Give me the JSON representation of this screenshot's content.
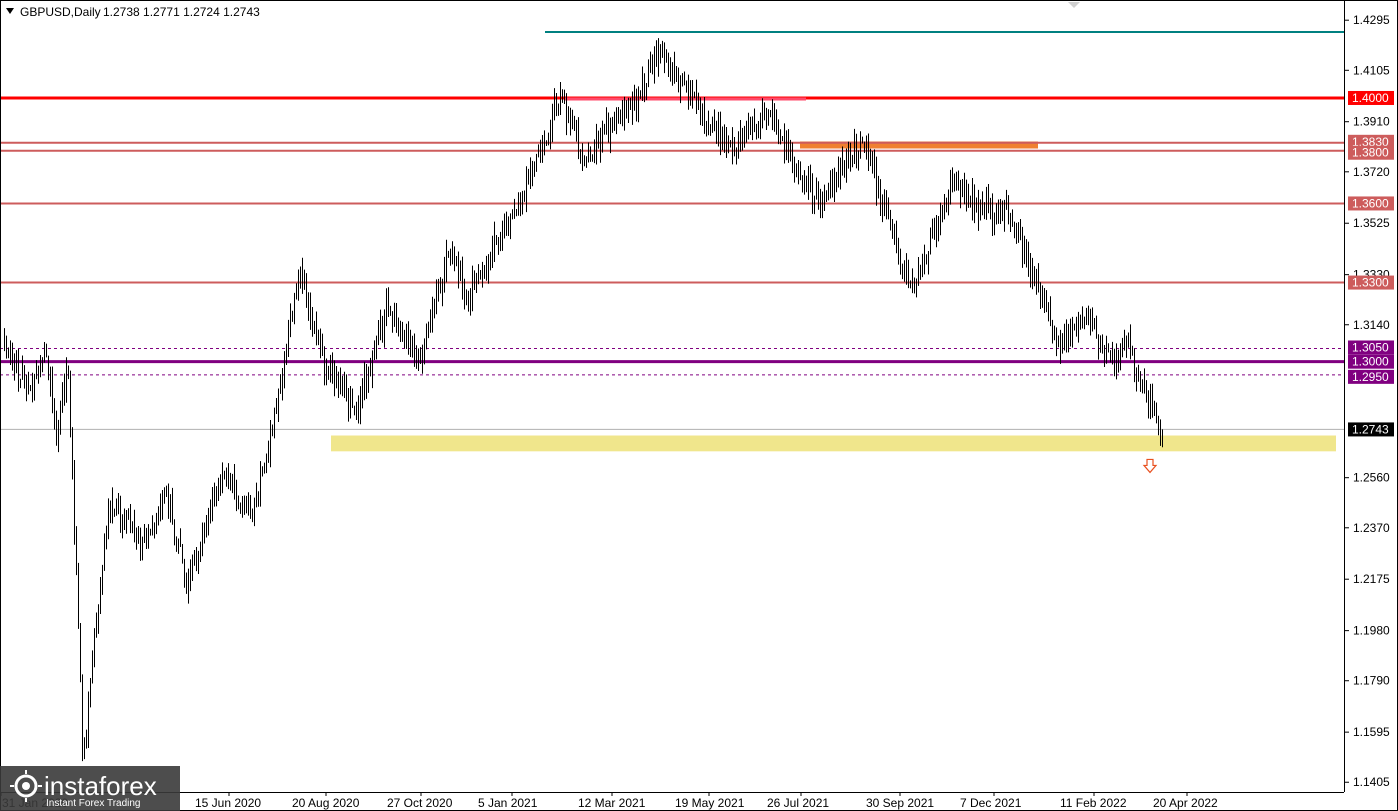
{
  "header": {
    "symbol": "GBPUSD,Daily",
    "ohlc": "1.2738 1.2771 1.2724 1.2743",
    "menu_icon": "triangle-down-icon"
  },
  "watermark": {
    "brand": "instaforex",
    "tagline": "Instant Forex Trading",
    "icon": "sun-logo-icon"
  },
  "chart_data": {
    "type": "candlestick",
    "symbol": "GBPUSD",
    "timeframe": "Daily",
    "last_price": 1.2743,
    "ylim": [
      1.1368,
      1.4364
    ],
    "y_ticks": [
      1.4295,
      1.4105,
      1.391,
      1.372,
      1.3525,
      1.333,
      1.314,
      1.256,
      1.237,
      1.2175,
      1.198,
      1.179,
      1.1595,
      1.1405
    ],
    "x_labels": [
      "31 Jan 2020",
      "15 Jun 2020",
      "20 Aug 2020",
      "27 Oct 2020",
      "5 Jan 2021",
      "12 Mar 2021",
      "19 May 2021",
      "26 Jul 2021",
      "30 Sep 2021",
      "7 Dec 2021",
      "11 Feb 2022",
      "20 Apr 2022"
    ],
    "price_path": [
      [
        1.308,
        0
      ],
      [
        1.29,
        0.02
      ],
      [
        1.302,
        0.035
      ],
      [
        1.275,
        0.045
      ],
      [
        1.3,
        0.055
      ],
      [
        1.15,
        0.068
      ],
      [
        1.248,
        0.09
      ],
      [
        1.23,
        0.12
      ],
      [
        1.25,
        0.14
      ],
      [
        1.215,
        0.158
      ],
      [
        1.258,
        0.188
      ],
      [
        1.24,
        0.215
      ],
      [
        1.29,
        0.238
      ],
      [
        1.335,
        0.255
      ],
      [
        1.3,
        0.275
      ],
      [
        1.282,
        0.305
      ],
      [
        1.32,
        0.33
      ],
      [
        1.3,
        0.36
      ],
      [
        1.345,
        0.385
      ],
      [
        1.325,
        0.4
      ],
      [
        1.365,
        0.45
      ],
      [
        1.4,
        0.48
      ],
      [
        1.378,
        0.5
      ],
      [
        1.398,
        0.545
      ],
      [
        1.418,
        0.565
      ],
      [
        1.398,
        0.595
      ],
      [
        1.382,
        0.63
      ],
      [
        1.395,
        0.66
      ],
      [
        1.376,
        0.68
      ],
      [
        1.36,
        0.705
      ],
      [
        1.385,
        0.74
      ],
      [
        1.325,
        0.785
      ],
      [
        1.37,
        0.82
      ],
      [
        1.358,
        0.84
      ],
      [
        1.356,
        0.87
      ],
      [
        1.306,
        0.91
      ],
      [
        1.315,
        0.935
      ],
      [
        1.3,
        0.955
      ],
      [
        1.305,
        0.97
      ],
      [
        1.274,
        1.0
      ]
    ],
    "series_color": "#000000",
    "levels": [
      {
        "value": 1.425,
        "color": "#008080",
        "tag": "",
        "extent": "from-peak"
      },
      {
        "value": 1.4,
        "color": "#ff0000",
        "tag": "1.4000",
        "extent": "full"
      },
      {
        "value": 1.383,
        "color": "#cd5c5c",
        "tag": "1.3830",
        "extent": "full"
      },
      {
        "value": 1.38,
        "color": "#cd5c5c",
        "tag": "1.3800",
        "extent": "full"
      },
      {
        "value": 1.36,
        "color": "#cd5c5c",
        "tag": "1.3600",
        "extent": "full"
      },
      {
        "value": 1.33,
        "color": "#cd5c5c",
        "tag": "1.3300",
        "extent": "full"
      },
      {
        "value": 1.3,
        "color": "#800080",
        "tag": "1.3000",
        "extent": "full"
      },
      {
        "value": 1.305,
        "color": "#800080",
        "tag": "1.3050",
        "extent": "dashed"
      },
      {
        "value": 1.295,
        "color": "#800080",
        "tag": "1.2950",
        "extent": "dashed"
      }
    ],
    "zones": [
      {
        "name": "orange-resistance-zone",
        "from": 1.3815,
        "to": 1.3835,
        "color": "#f08030"
      },
      {
        "name": "yellow-support-zone",
        "from": 1.266,
        "to": 1.272,
        "color": "#f0e68c"
      }
    ],
    "current_price_tag": "1.2743",
    "annotation": {
      "type": "down-arrow",
      "color": "#e8501f"
    }
  }
}
